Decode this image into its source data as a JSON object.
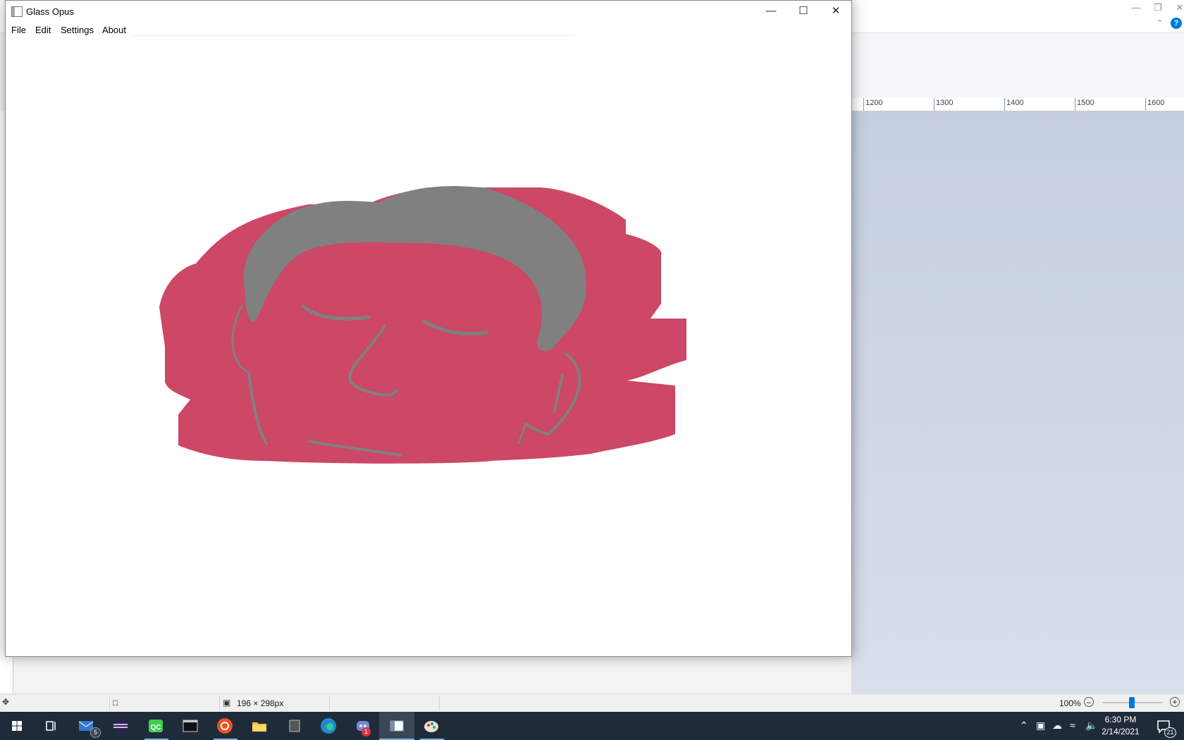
{
  "window": {
    "title": "Glass Opus",
    "menu": [
      "File",
      "Edit",
      "Settings",
      "About"
    ]
  },
  "background_app": {
    "ruler_labels": [
      "1200",
      "1300",
      "1400",
      "1500",
      "1600"
    ],
    "status": {
      "selection_size": "196 × 298px",
      "zoom": "100%"
    }
  },
  "taskbar": {
    "time": "6:30 PM",
    "date": "2/14/2021",
    "mail_badge": "5",
    "discord_badge": "1",
    "notifications_badge": "21"
  },
  "colors": {
    "face_fill": "#cd4766",
    "hair_fill": "#808080",
    "taskbar": "#202b3a",
    "accent": "#0078d7"
  },
  "icons": [
    "windows-start-icon",
    "task-view-icon",
    "mail-icon",
    "eclipse-icon",
    "qt-creator-icon",
    "terminal-icon",
    "ubuntu-icon",
    "file-explorer-icon",
    "app-icon",
    "edge-icon",
    "discord-icon",
    "glass-opus-icon",
    "paint-icon"
  ]
}
